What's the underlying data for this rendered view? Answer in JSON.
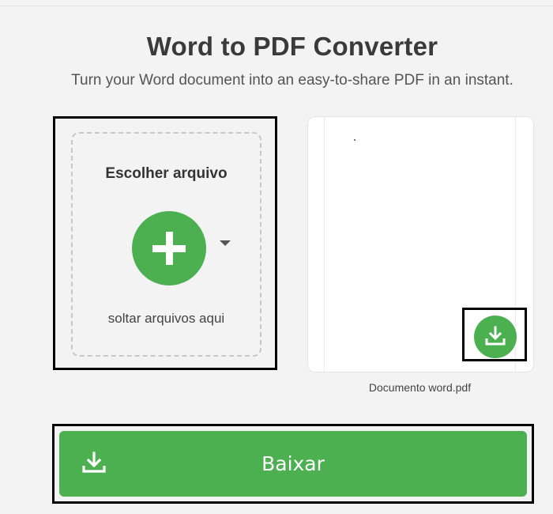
{
  "header": {
    "title": "Word to PDF Converter",
    "subtitle": "Turn your Word document into an easy-to-share PDF in an instant."
  },
  "upload": {
    "choose_label": "Escolher arquivo",
    "drop_text": "soltar arquivos aqui",
    "add_icon": "plus-icon",
    "menu_icon": "caret-down-icon"
  },
  "preview": {
    "filename": "Documento word.pdf",
    "download_icon": "download-icon"
  },
  "download_button": {
    "label": "Baixar",
    "icon": "download-icon"
  },
  "colors": {
    "accent": "#4caf50",
    "background": "#f3f3f3"
  }
}
